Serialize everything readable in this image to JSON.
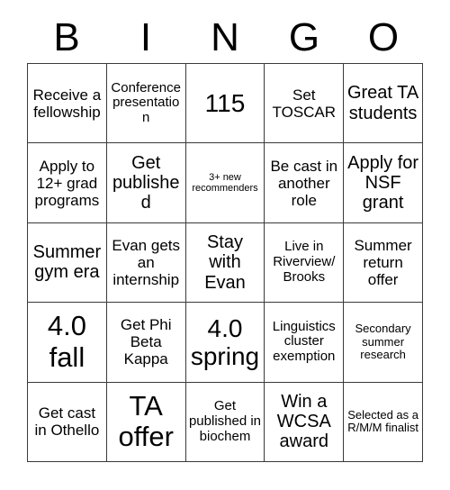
{
  "card": {
    "header_letters": [
      "B",
      "I",
      "N",
      "G",
      "O"
    ],
    "columns": 5,
    "rows": 5,
    "border_color": "#3a3a3a",
    "background_color": "#ffffff",
    "text_color": "#000000",
    "cells": [
      {
        "text": "Receive a fellowship",
        "size": "md"
      },
      {
        "text": "Conference presentation",
        "size": "sm"
      },
      {
        "text": "115",
        "size": "xl"
      },
      {
        "text": "Set TOSCAR",
        "size": "md"
      },
      {
        "text": "Great TA students",
        "size": "lg"
      },
      {
        "text": "Apply to 12+ grad programs",
        "size": "md"
      },
      {
        "text": "Get published",
        "size": "lg"
      },
      {
        "text": "3+ new recommenders",
        "size": "xxs"
      },
      {
        "text": "Be cast in another role",
        "size": "md"
      },
      {
        "text": "Apply for NSF grant",
        "size": "lg"
      },
      {
        "text": "Summer gym era",
        "size": "lg"
      },
      {
        "text": "Evan gets an internship",
        "size": "md"
      },
      {
        "text": "Stay with Evan",
        "size": "lg"
      },
      {
        "text": "Live in Riverview/ Brooks",
        "size": "sm"
      },
      {
        "text": "Summer return offer",
        "size": "md"
      },
      {
        "text": "4.0 fall",
        "size": "xxl"
      },
      {
        "text": "Get Phi Beta Kappa",
        "size": "md"
      },
      {
        "text": "4.0 spring",
        "size": "xl"
      },
      {
        "text": "Linguistics cluster exemption",
        "size": "sm"
      },
      {
        "text": "Secondary summer research",
        "size": "xs"
      },
      {
        "text": "Get cast in Othello",
        "size": "md"
      },
      {
        "text": "TA offer",
        "size": "xxl"
      },
      {
        "text": "Get published in biochem",
        "size": "sm"
      },
      {
        "text": "Win a WCSA award",
        "size": "lg"
      },
      {
        "text": "Selected as a R/M/M finalist",
        "size": "xs"
      }
    ]
  }
}
